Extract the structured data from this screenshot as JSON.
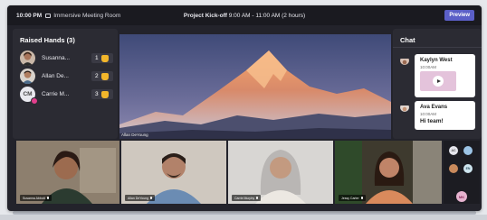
{
  "topbar": {
    "time": "10:00 PM",
    "room_name": "Immersive Meeting Room",
    "meeting_title": "Project Kick-off",
    "meeting_time": "9:00 AM - 11:00 AM (2 hours)",
    "preview_label": "Preview"
  },
  "raised_hands": {
    "title": "Raised Hands (3)",
    "items": [
      {
        "name": "Susanna...",
        "number": "1",
        "avatar": "photo"
      },
      {
        "name": "Allan De...",
        "number": "2",
        "avatar": "photo"
      },
      {
        "name": "Carrie M...",
        "number": "3",
        "avatar_initials": "CM"
      }
    ]
  },
  "stage": {
    "presenter_label": "Allan DeYoung"
  },
  "chat": {
    "title": "Chat",
    "messages": [
      {
        "sender": "Kaylyn West",
        "time": "10:00AM",
        "attachment": "video"
      },
      {
        "sender": "Ava Evans",
        "time": "10:00AM",
        "text": "Hi team!"
      }
    ]
  },
  "tiles": [
    {
      "label": "Susanna Abbott",
      "active": true
    },
    {
      "label": "Allan DeYoung",
      "active": true
    },
    {
      "label": "Carrie Murphy",
      "active": true
    },
    {
      "label": "Jessy Carter",
      "active": false
    }
  ],
  "roster": {
    "avatars": [
      {
        "initials": "AC",
        "color": "#e6e6ec"
      },
      {
        "initials": "",
        "color": "#9cc4e6"
      },
      {
        "initials": "",
        "color": "#c98a5c"
      },
      {
        "initials": "EN",
        "color": "#cfe6f0"
      },
      {
        "initials": "MK",
        "color": "#e6b3cf"
      }
    ]
  },
  "colors": {
    "accent": "#5b5fc7",
    "active_tile_border": "#e9c645",
    "hand_emoji": "#f2b62b",
    "presence": "#e23e8c"
  }
}
